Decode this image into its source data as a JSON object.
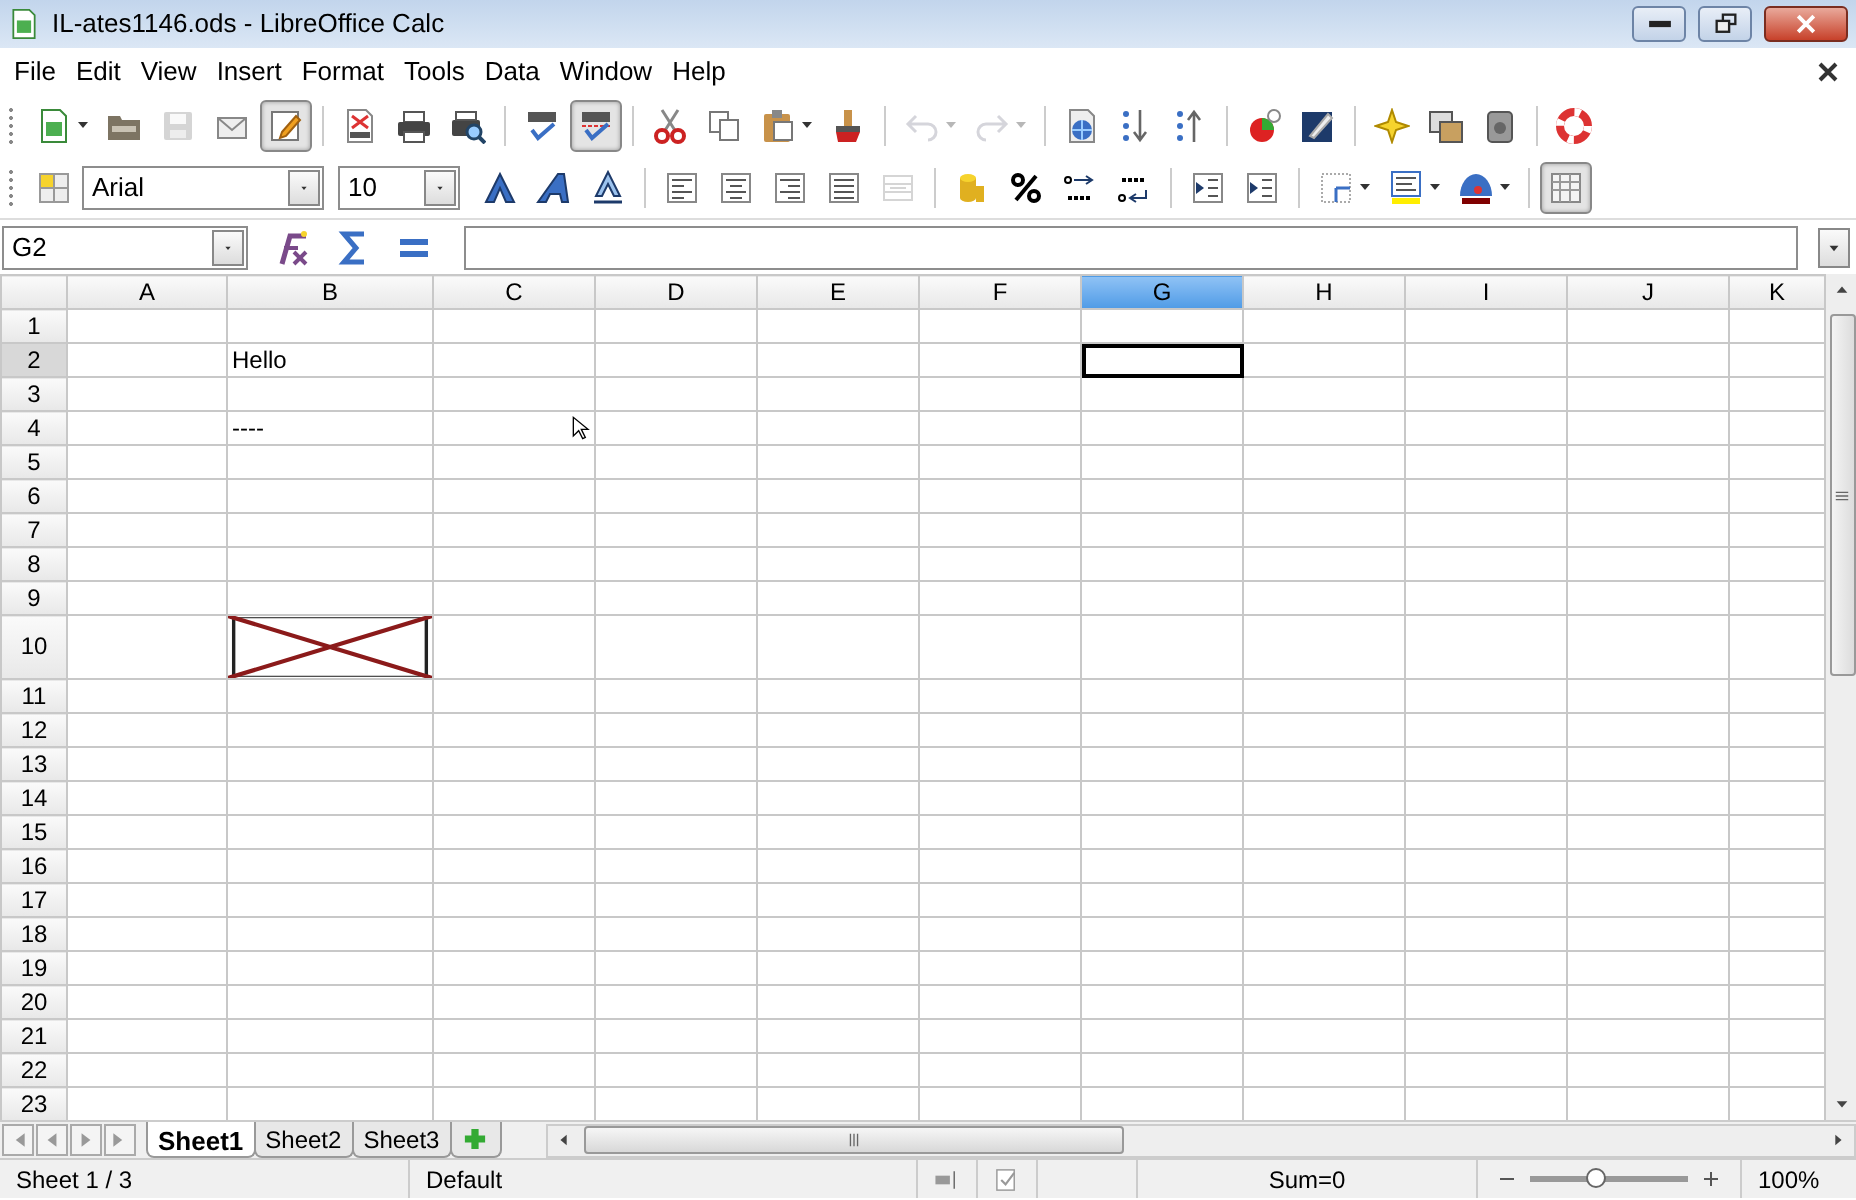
{
  "window": {
    "title": "IL-ates1146.ods - LibreOffice Calc"
  },
  "menu": [
    {
      "label": "File"
    },
    {
      "label": "Edit"
    },
    {
      "label": "View"
    },
    {
      "label": "Insert"
    },
    {
      "label": "Format"
    },
    {
      "label": "Tools"
    },
    {
      "label": "Data"
    },
    {
      "label": "Window"
    },
    {
      "label": "Help"
    }
  ],
  "standard_toolbar": [
    {
      "kind": "new",
      "dropdown": true
    },
    {
      "kind": "open"
    },
    {
      "kind": "save",
      "disabled": true
    },
    {
      "kind": "email"
    },
    {
      "kind": "edit",
      "pressed": true
    },
    {
      "kind": "separator"
    },
    {
      "kind": "pdf"
    },
    {
      "kind": "print"
    },
    {
      "kind": "preview"
    },
    {
      "kind": "separator"
    },
    {
      "kind": "spell"
    },
    {
      "kind": "autospell",
      "pressed": true
    },
    {
      "kind": "separator"
    },
    {
      "kind": "cut"
    },
    {
      "kind": "copy"
    },
    {
      "kind": "paste",
      "dropdown": true
    },
    {
      "kind": "clone"
    },
    {
      "kind": "separator"
    },
    {
      "kind": "undo",
      "disabled": true,
      "dropdown": true
    },
    {
      "kind": "redo",
      "disabled": true,
      "dropdown": true
    },
    {
      "kind": "separator"
    },
    {
      "kind": "hyperlink"
    },
    {
      "kind": "sortasc"
    },
    {
      "kind": "sortdesc"
    },
    {
      "kind": "separator"
    },
    {
      "kind": "chart"
    },
    {
      "kind": "draw"
    },
    {
      "kind": "separator"
    },
    {
      "kind": "navigator"
    },
    {
      "kind": "gallery"
    },
    {
      "kind": "datasource"
    },
    {
      "kind": "separator"
    },
    {
      "kind": "help"
    }
  ],
  "formatting_toolbar": [
    {
      "kind": "styles"
    },
    {
      "kind": "fontname",
      "value": "Arial"
    },
    {
      "kind": "fontsize",
      "value": "10"
    },
    {
      "kind": "bold"
    },
    {
      "kind": "italic"
    },
    {
      "kind": "underline"
    },
    {
      "kind": "separator"
    },
    {
      "kind": "alignleft"
    },
    {
      "kind": "aligncenter"
    },
    {
      "kind": "alignright"
    },
    {
      "kind": "justify"
    },
    {
      "kind": "merge",
      "disabled": true
    },
    {
      "kind": "separator"
    },
    {
      "kind": "currency"
    },
    {
      "kind": "percent"
    },
    {
      "kind": "adddecimal"
    },
    {
      "kind": "deldecimal"
    },
    {
      "kind": "separator"
    },
    {
      "kind": "outdent"
    },
    {
      "kind": "indent"
    },
    {
      "kind": "separator"
    },
    {
      "kind": "borders",
      "dropdown": true
    },
    {
      "kind": "bgcolor",
      "dropdown": true
    },
    {
      "kind": "fontcolor",
      "dropdown": true
    },
    {
      "kind": "separator"
    },
    {
      "kind": "gridlines",
      "pressed": true
    }
  ],
  "formula_bar": {
    "name_box": "G2"
  },
  "columns": [
    {
      "label": "A",
      "selected": false
    },
    {
      "label": "B",
      "selected": false
    },
    {
      "label": "C",
      "selected": false
    },
    {
      "label": "D",
      "selected": false
    },
    {
      "label": "E",
      "selected": false
    },
    {
      "label": "F",
      "selected": false
    },
    {
      "label": "G",
      "selected": true
    },
    {
      "label": "H",
      "selected": false
    },
    {
      "label": "I",
      "selected": false
    },
    {
      "label": "J",
      "selected": false
    },
    {
      "label": "K",
      "selected": false
    }
  ],
  "rows": [
    {
      "label": "1",
      "selected": false
    },
    {
      "label": "2",
      "selected": true,
      "cells": {
        "column_2": {
          "kind": "text",
          "text": "Hello"
        },
        "column_7": {
          "kind": "empty",
          "selected": true
        }
      }
    },
    {
      "label": "3",
      "selected": false
    },
    {
      "label": "4",
      "selected": false,
      "cells": {
        "column_2": {
          "kind": "text",
          "text": "----"
        }
      }
    },
    {
      "label": "5",
      "selected": false
    },
    {
      "label": "6",
      "selected": false
    },
    {
      "label": "7",
      "selected": false
    },
    {
      "label": "8",
      "selected": false
    },
    {
      "label": "9",
      "selected": false
    },
    {
      "label": "10",
      "selected": false,
      "cells": {
        "column_2": {
          "kind": "broken-image"
        }
      }
    },
    {
      "label": "11",
      "selected": false
    },
    {
      "label": "12",
      "selected": false
    },
    {
      "label": "13",
      "selected": false
    },
    {
      "label": "14",
      "selected": false
    },
    {
      "label": "15",
      "selected": false
    },
    {
      "label": "16",
      "selected": false
    },
    {
      "label": "17",
      "selected": false
    },
    {
      "label": "18",
      "selected": false
    },
    {
      "label": "19",
      "selected": false
    },
    {
      "label": "20",
      "selected": false
    },
    {
      "label": "21",
      "selected": false
    },
    {
      "label": "22",
      "selected": false
    },
    {
      "label": "23",
      "selected": false
    }
  ],
  "sheet_tabs": [
    {
      "label": "Sheet1",
      "selected": true
    },
    {
      "label": "Sheet2",
      "selected": false
    },
    {
      "label": "Sheet3",
      "selected": false
    }
  ],
  "status_bar": {
    "sheet": "Sheet 1 / 3",
    "page_style": "Default",
    "sum": "Sum=0",
    "zoom": {
      "level": 0.42,
      "reading": "100%"
    }
  }
}
